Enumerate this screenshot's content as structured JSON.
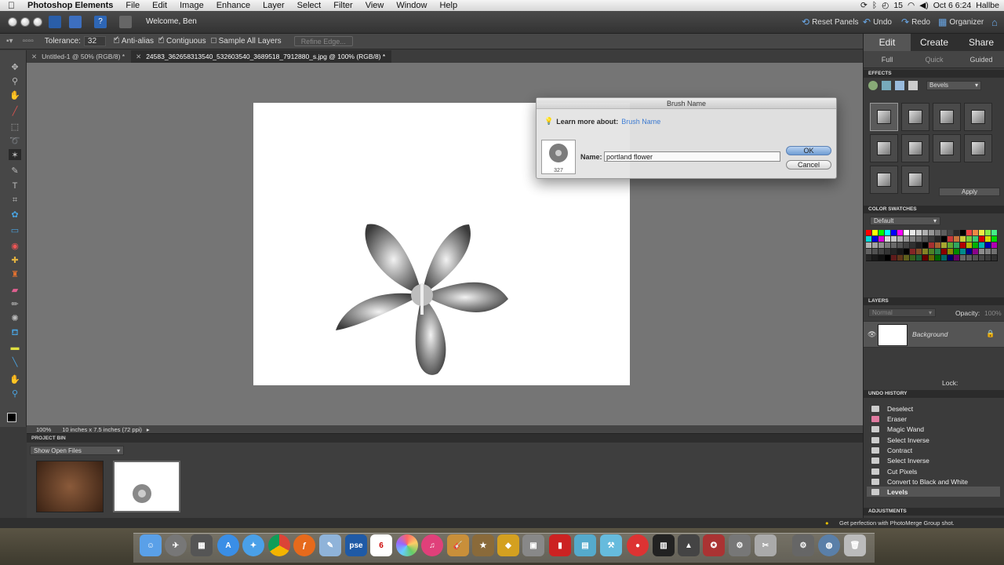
{
  "menubar": {
    "app_name": "Photoshop Elements",
    "items": [
      "File",
      "Edit",
      "Image",
      "Enhance",
      "Layer",
      "Select",
      "Filter",
      "View",
      "Window",
      "Help"
    ],
    "battery": "15",
    "clock": "Oct 6  6:24",
    "user": "Hallbe"
  },
  "topbar": {
    "welcome": "Welcome, Ben",
    "reset_panels": "Reset Panels",
    "undo": "Undo",
    "redo": "Redo",
    "organizer": "Organizer"
  },
  "options": {
    "tolerance_label": "Tolerance:",
    "tolerance_value": "32",
    "anti_alias": "Anti-alias",
    "contiguous": "Contiguous",
    "sample_all_layers": "Sample All Layers",
    "refine_edge": "Refine Edge..."
  },
  "tabs": [
    {
      "label": "Untitled-1 @ 50% (RGB/8) *"
    },
    {
      "label": "24583_362658313540_532603540_3689518_7912880_s.jpg @ 100% (RGB/8) *"
    }
  ],
  "status": {
    "zoom": "100%",
    "doc_size": "10 inches x 7.5 inches (72 ppi)"
  },
  "bin": {
    "title": "PROJECT BIN",
    "show": "Show Open Files"
  },
  "right_panel": {
    "modes": [
      "Edit",
      "Create",
      "Share"
    ],
    "submodes": [
      "Full",
      "Quick",
      "Guided"
    ],
    "effects_title": "EFFECTS",
    "effects_select": "Bevels",
    "apply": "Apply",
    "swatches_title": "COLOR SWATCHES",
    "swatches_select": "Default",
    "layers_title": "LAYERS",
    "blend_mode": "Normal",
    "opacity_label": "Opacity:",
    "opacity_value": "100%",
    "layer_name": "Background",
    "lock_label": "Lock:",
    "undo_title": "UNDO HISTORY",
    "undo_items": [
      "Deselect",
      "Eraser",
      "Magic Wand",
      "Select Inverse",
      "Contract",
      "Select Inverse",
      "Cut Pixels",
      "Convert to Black and White",
      "Levels"
    ],
    "adjustments_title": "ADJUSTMENTS"
  },
  "dialog": {
    "title": "Brush Name",
    "learn_more": "Learn more about:",
    "learn_link": "Brush Name",
    "brush_size": "327",
    "name_label": "Name:",
    "name_value": "portland flower",
    "ok": "OK",
    "cancel": "Cancel"
  },
  "app_status": {
    "tip": "Get perfection with PhotoMerge Group shot."
  },
  "dock": {
    "calendar_day": "6",
    "pse_label": "pse"
  },
  "swatch_colors": [
    "#ff0000",
    "#ffff00",
    "#00ff00",
    "#00ffff",
    "#0000ff",
    "#ff00ff",
    "#ffffff",
    "#e8e8e8",
    "#cccccc",
    "#b0b0b0",
    "#969696",
    "#7a7a7a",
    "#5e5e5e",
    "#444444",
    "#2a2a2a",
    "#000000",
    "#ee4444",
    "#ee8844",
    "#eeee44",
    "#88ee44",
    "#44ee88"
  ]
}
